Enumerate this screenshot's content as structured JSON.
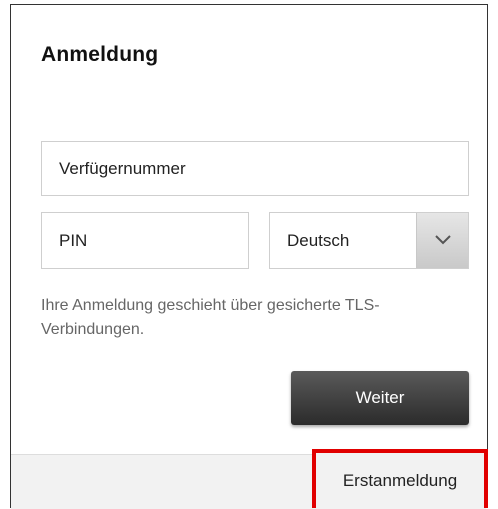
{
  "login": {
    "title": "Anmeldung",
    "account_placeholder": "Verfügernummer",
    "pin_placeholder": "PIN",
    "language_selected": "Deutsch",
    "security_note": "Ihre Anmeldung geschieht über gesicherte TLS-Verbindungen.",
    "submit_label": "Weiter"
  },
  "footer": {
    "first_login_label": "Erstanmeldung"
  },
  "icons": {
    "language_dropdown": "chevron-down-icon"
  },
  "colors": {
    "highlight": "#e10000",
    "button_dark": "#2b2b2b"
  }
}
